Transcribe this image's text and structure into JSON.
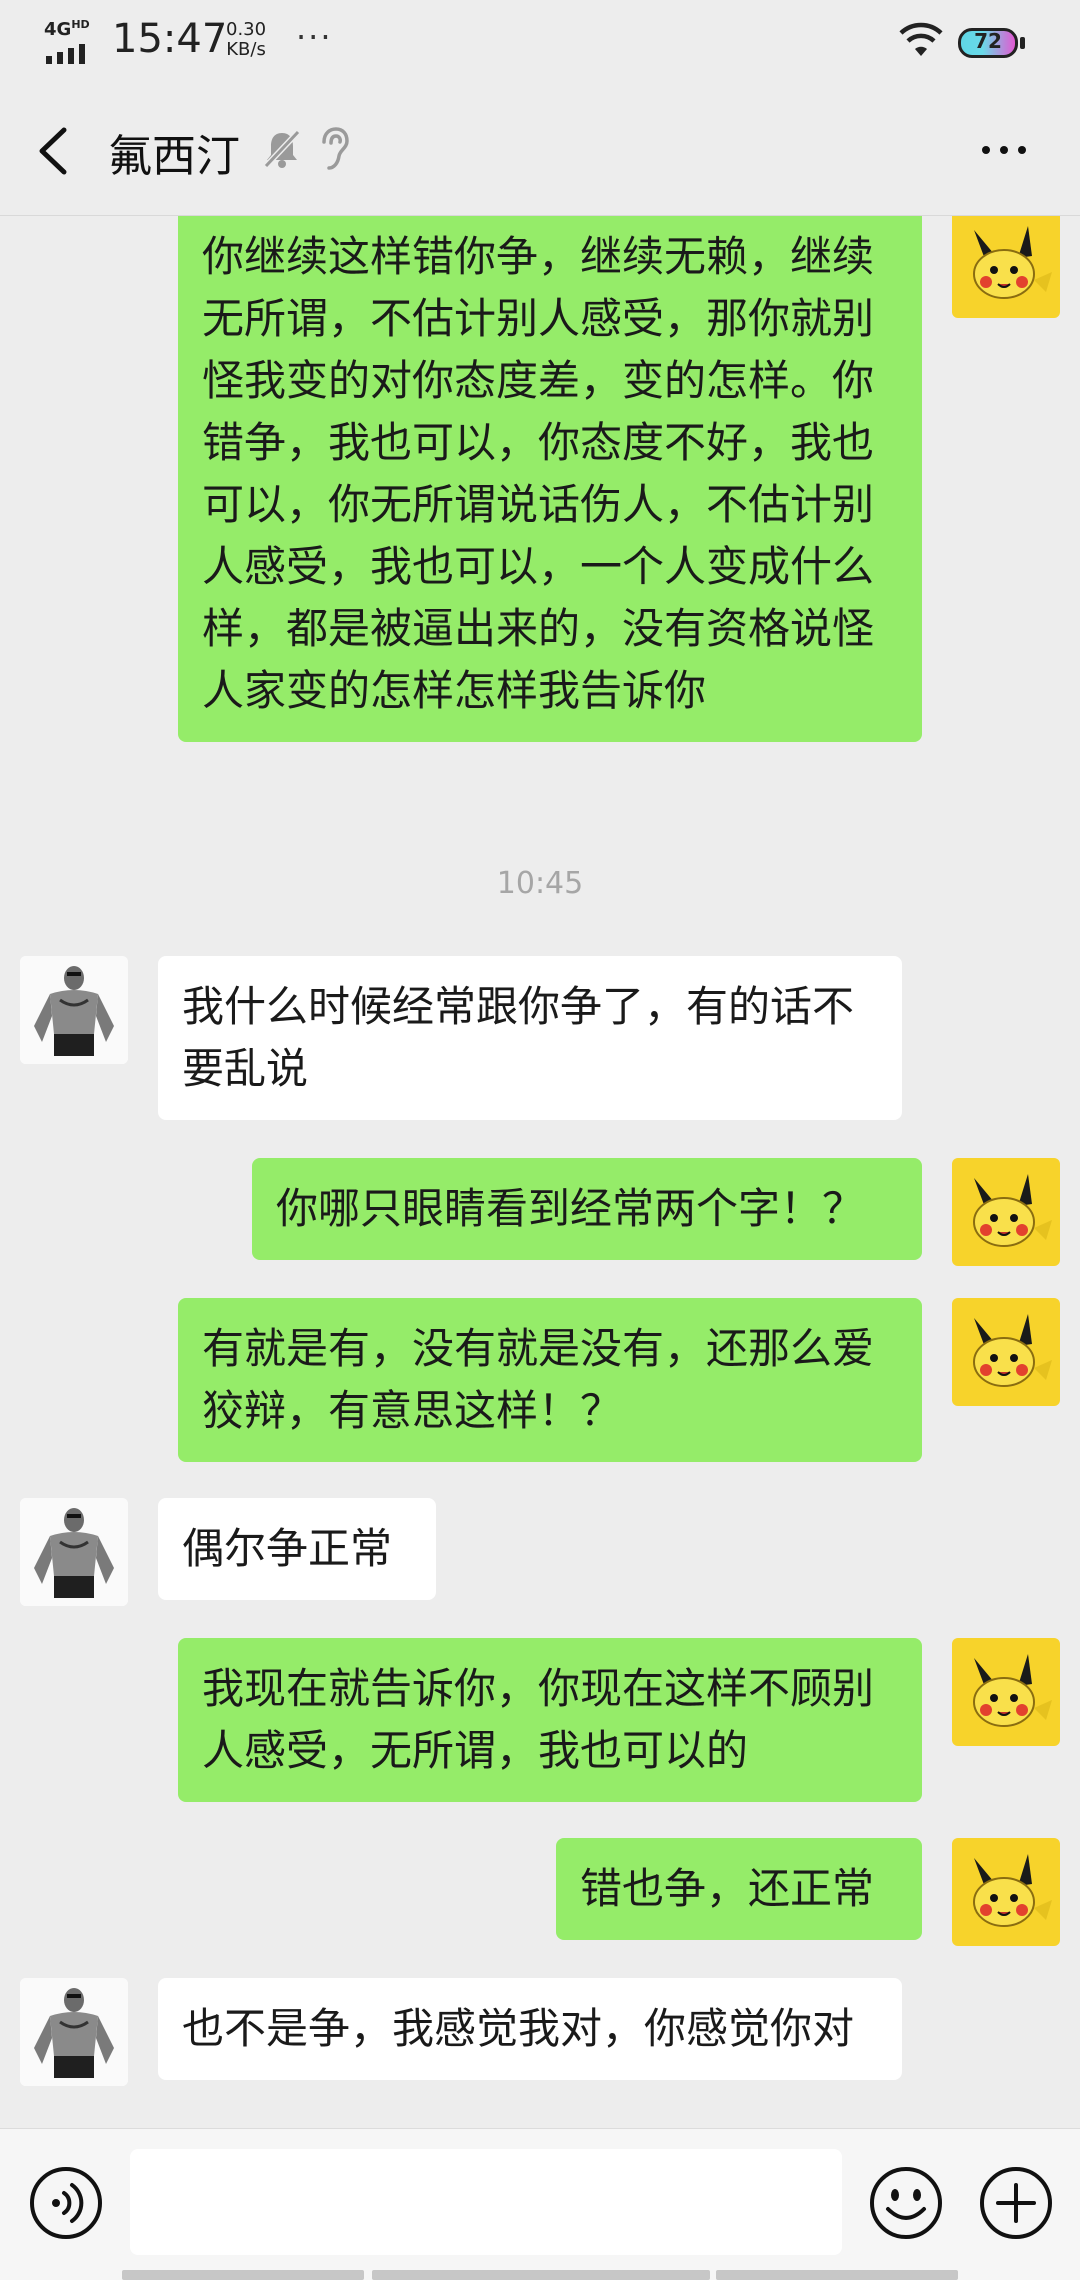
{
  "status_bar": {
    "network": "4G",
    "network_sup": "HD",
    "time": "15:47",
    "speed_value": "0.30",
    "speed_unit": "KB/s",
    "more": "···",
    "battery": "72"
  },
  "header": {
    "contact_name": "氟西汀",
    "icons": [
      "back-icon",
      "mute-bell-icon",
      "ear-icon",
      "more-icon"
    ]
  },
  "messages": [
    {
      "sender": "self",
      "text": "你继续这样错你争，继续无赖，继续无所谓，不估计别人感受，那你就别怪我变的对你态度差，变的怎样。你错争，我也可以，你态度不好，我也可以，你无所谓说话伤人，不估计别人感受，我也可以，一个人变成什么样，都是被逼出来的，没有资格说怪人家变的怎样怎样我告诉你"
    },
    {
      "timestamp": "10:45"
    },
    {
      "sender": "other",
      "text": "我什么时候经常跟你争了，有的话不要乱说"
    },
    {
      "sender": "self",
      "text": "你哪只眼睛看到经常两个字！？"
    },
    {
      "sender": "self",
      "text": "有就是有，没有就是没有，还那么爱狡辩，有意思这样！？"
    },
    {
      "sender": "other",
      "text": "偶尔争正常"
    },
    {
      "sender": "self",
      "text": "我现在就告诉你，你现在这样不顾别人感受，无所谓，我也可以的"
    },
    {
      "sender": "self",
      "text": "错也争，还正常"
    },
    {
      "sender": "other",
      "text": "也不是争，我感觉我对，你感觉你对"
    }
  ],
  "input_bar": {
    "placeholder": "",
    "icons": [
      "voice-icon",
      "emoji-icon",
      "plus-icon"
    ]
  },
  "colors": {
    "self_bubble": "#95ec69",
    "other_bubble": "#ffffff",
    "background": "#ededed",
    "self_avatar_bg": "#f7d32b"
  }
}
